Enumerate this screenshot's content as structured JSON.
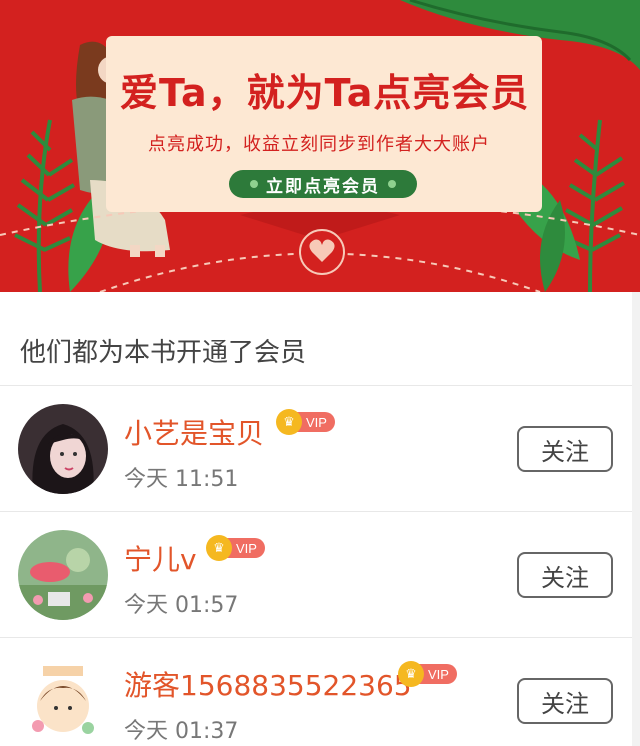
{
  "banner": {
    "title": "爱Ta，就为Ta点亮会员",
    "subtitle": "点亮成功，收益立刻同步到作者大大账户",
    "cta_label": "立即点亮会员",
    "colors": {
      "background": "#d3211f",
      "card": "#fde8d3",
      "button": "#2d7a3a"
    }
  },
  "section": {
    "title": "他们都为本书开通了会员"
  },
  "members": [
    {
      "name": "小艺是宝贝",
      "badge": "VIP",
      "time": "今天 11:51",
      "follow_label": "关注"
    },
    {
      "name": "宁儿v",
      "badge": "VIP",
      "time": "今天 01:57",
      "follow_label": "关注"
    },
    {
      "name": "游客1568835522365",
      "badge": "VIP",
      "time": "今天 01:37",
      "follow_label": "关注"
    }
  ],
  "icons": {
    "vip_badge": "crown-icon",
    "banner_emblem": "heart-icon"
  }
}
